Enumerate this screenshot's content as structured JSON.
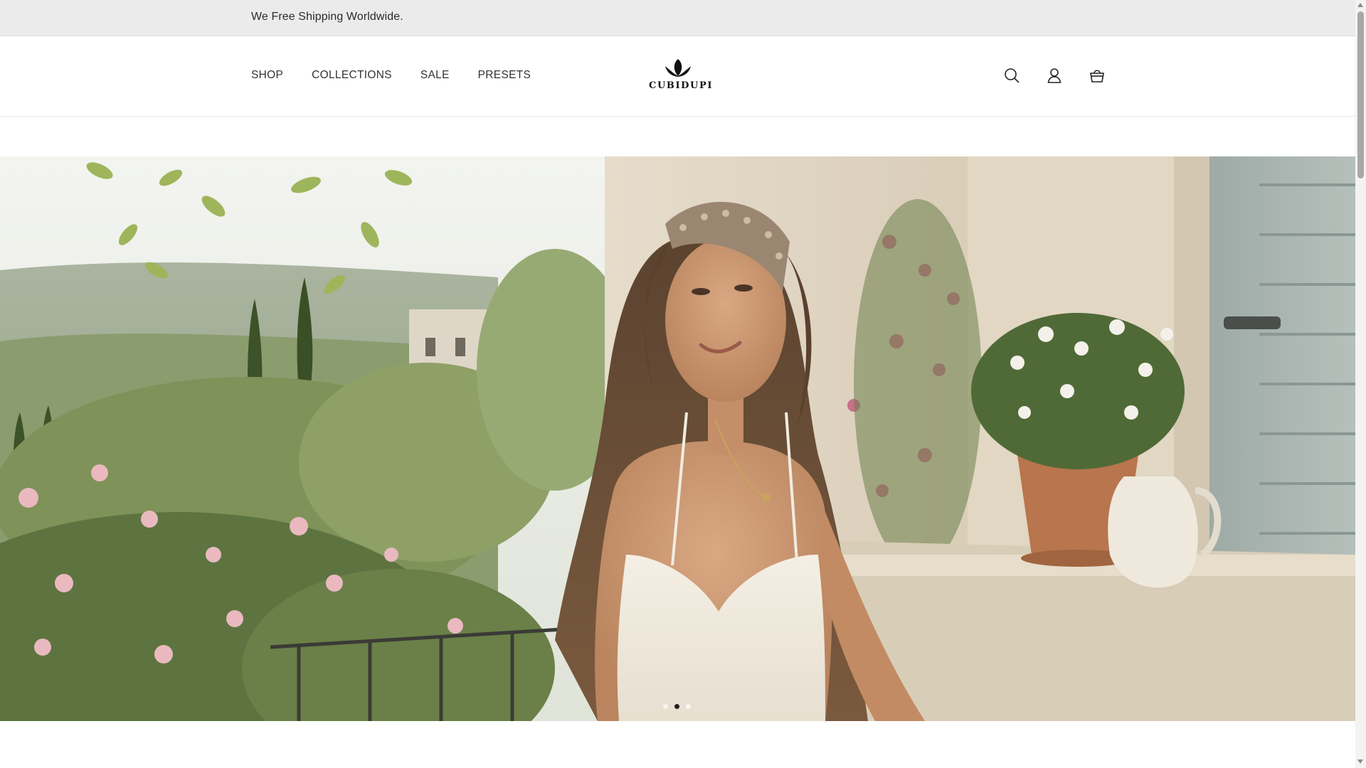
{
  "announcement": {
    "text": "We  Free Shipping Worldwide."
  },
  "nav": {
    "items": [
      {
        "label": "SHOP"
      },
      {
        "label": "COLLECTIONS"
      },
      {
        "label": "SALE"
      },
      {
        "label": "PRESETS"
      }
    ]
  },
  "brand": {
    "name": "CUBIDUPI"
  },
  "header_icons": [
    "search-icon",
    "account-icon",
    "cart-icon"
  ],
  "hero": {
    "slide_count": 3,
    "active_slide": 2,
    "image_description_icon": "hero-photo"
  },
  "colors": {
    "announcement_bg": "#ebebeb",
    "text": "#333333",
    "active_dot": "#222222"
  }
}
